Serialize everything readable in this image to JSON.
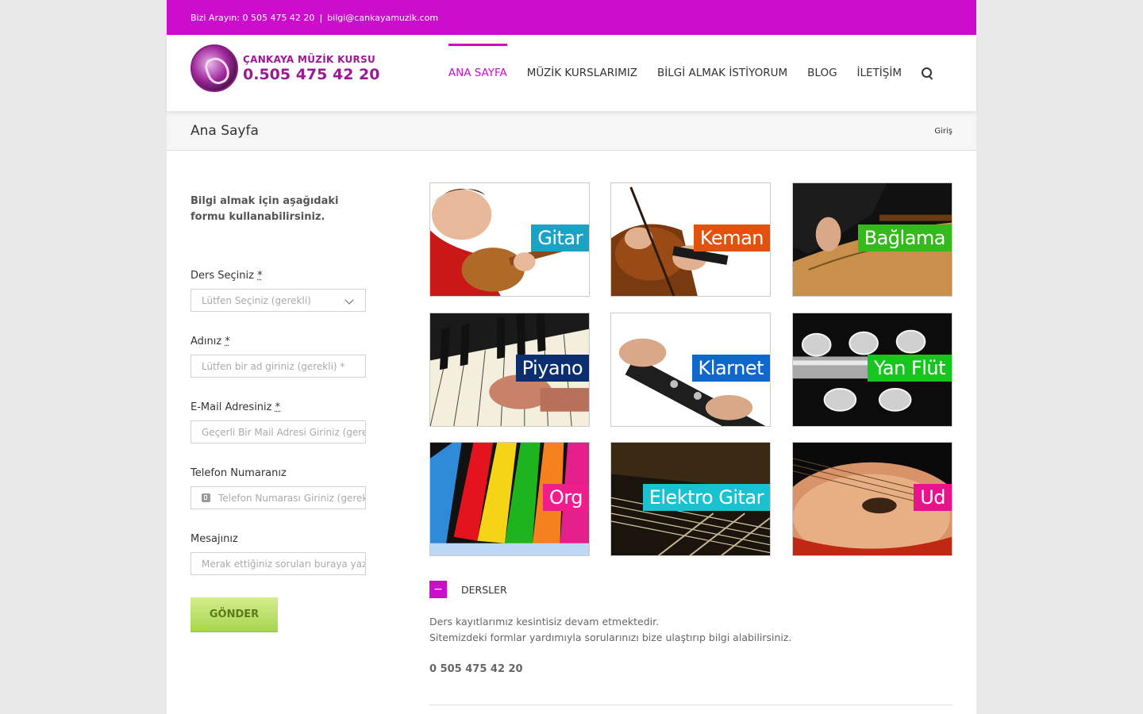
{
  "topbar": {
    "call_text": "Bizi Arayın: 0 505 475 42 20",
    "separator": "|",
    "email": "bilgi@cankayamuzik.com"
  },
  "logo": {
    "name": "ÇANKAYA MÜZİK KURSU",
    "phone": "0.505 475 42 20"
  },
  "nav": {
    "items": [
      {
        "label": "ANA SAYFA",
        "active": true
      },
      {
        "label": "MÜZİK KURSLARIMIZ"
      },
      {
        "label": "BİLGİ ALMAK İSTİYORUM"
      },
      {
        "label": "BLOG"
      },
      {
        "label": "İLETİŞİM"
      }
    ],
    "search_icon": "search-icon"
  },
  "crumbbar": {
    "title": "Ana Sayfa",
    "breadcrumb": "Giriş"
  },
  "form": {
    "intro": "Bilgi almak için aşağıdaki formu kullanabilirsiniz.",
    "course_label": "Ders Seçiniz",
    "course_placeholder": "Lütfen Seçiniz (gerekli)",
    "name_label": "Adınız",
    "name_placeholder": "Lütfen bir ad giriniz (gerekli) *",
    "email_label": "E-Mail Adresiniz",
    "email_placeholder": "Geçerli Bir Mail Adresi Giriniz (gere",
    "phone_label": "Telefon Numaranız",
    "phone_placeholder": "Telefon Numarası Giriniz (gerek",
    "message_label": "Mesajınız",
    "message_placeholder": "Merak ettiğiniz soruları buraya yazı",
    "required_mark": "*",
    "submit": "GÖNDER"
  },
  "courses": [
    {
      "label": "Gitar",
      "color": "#1aa3c4"
    },
    {
      "label": "Keman",
      "color": "#e2520c"
    },
    {
      "label": "Bağlama",
      "color": "#35b91c"
    },
    {
      "label": "Piyano",
      "color": "#0b2f6e"
    },
    {
      "label": "Klarnet",
      "color": "#1068cc"
    },
    {
      "label": "Yan Flüt",
      "color": "#16c51e"
    },
    {
      "label": "Org",
      "color": "#f01e8c"
    },
    {
      "label": "Elektro Gitar",
      "color": "#18c3cf"
    },
    {
      "label": "Ud",
      "color": "#e8128a"
    }
  ],
  "accordion": {
    "toggle": "−",
    "title": "DERSLER",
    "line1": "Ders kayıtlarımız kesintisiz devam etmektedir.",
    "line2": "Sitemizdeki formlar yardımıyla sorularınızı bize ulaştırıp bilgi alabilirsiniz.",
    "phone": "0 505 475 42 20"
  },
  "colors": {
    "brand": "#cc0dcc",
    "submit": "#a6d64e"
  }
}
